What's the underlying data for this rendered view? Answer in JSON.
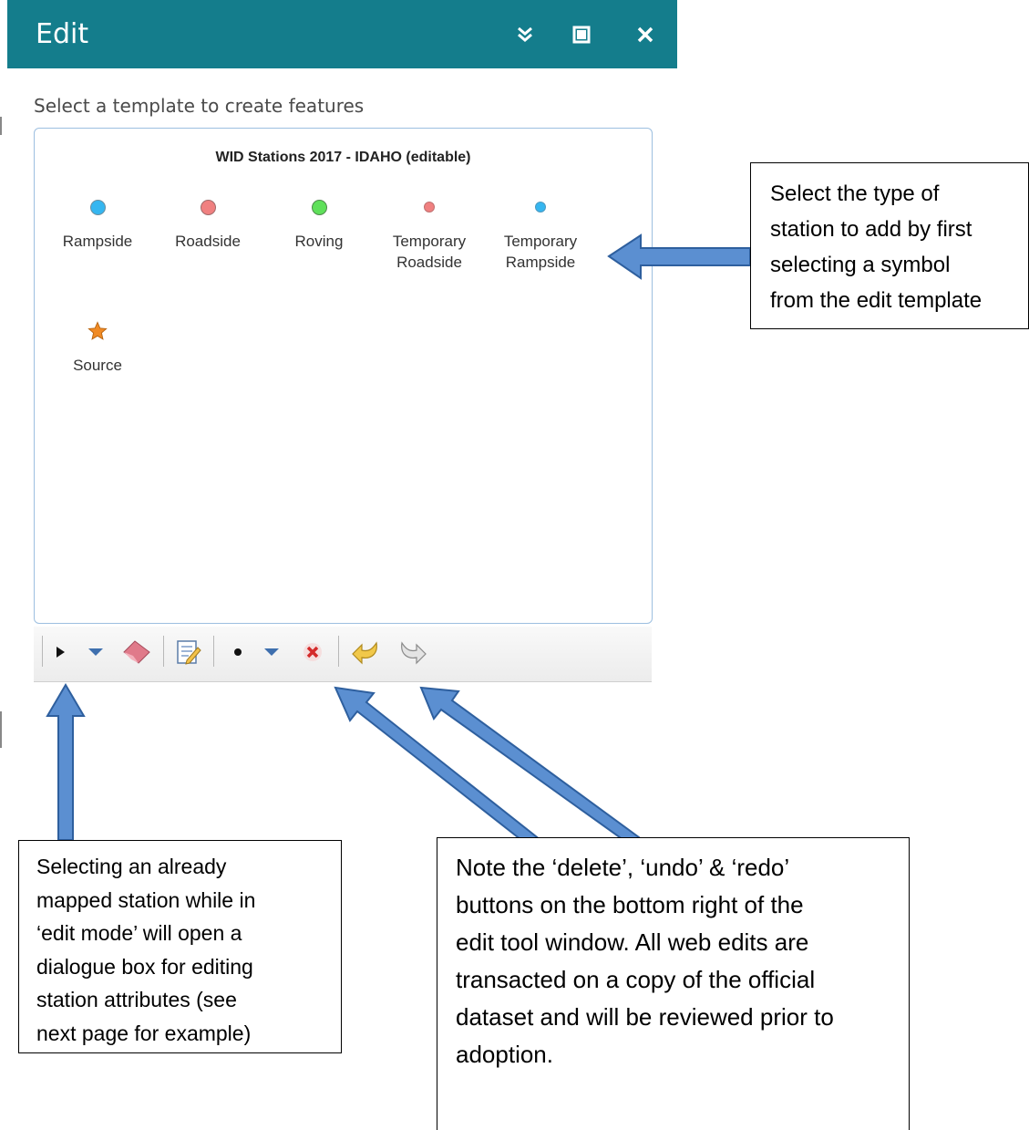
{
  "widget": {
    "title": "Edit",
    "hint": "Select a template to create features",
    "layer_title": "WID Stations 2017 - IDAHO (editable)",
    "templates": [
      {
        "label": "Rampside",
        "color": "#35b6f0",
        "symbol": "circle-large"
      },
      {
        "label": "Roadside",
        "color": "#f08080",
        "symbol": "circle-large"
      },
      {
        "label": "Roving",
        "color": "#5fe05a",
        "symbol": "circle-large"
      },
      {
        "label": "Temporary\nRoadside",
        "color": "#f08080",
        "symbol": "circle-small"
      },
      {
        "label": "Temporary\nRampside",
        "color": "#35b6f0",
        "symbol": "circle-small"
      },
      {
        "label": "Source",
        "color": "#f08a24",
        "symbol": "star"
      }
    ],
    "header_icons": [
      "collapse-chevrons-icon",
      "maximize-icon",
      "close-icon"
    ],
    "toolbar_icons": [
      "select-arrow-icon",
      "dropdown-triangle-icon",
      "eraser-icon",
      "edit-attributes-icon",
      "point-tool-icon",
      "dropdown-triangle-icon",
      "delete-icon",
      "undo-icon",
      "redo-icon"
    ]
  },
  "callouts": {
    "right": "Select the type of\nstation to add by first\nselecting a symbol\nfrom the edit template",
    "bottom_left": "Selecting an already\nmapped station while in\n‘edit mode’ will open a\ndialogue box for editing\nstation attributes (see\nnext page for example)",
    "bottom_right": "Note the ‘delete’, ‘undo’ & ‘redo’\nbuttons on the bottom right of the\nedit tool window.  All web edits are\ntransacted on a copy of the official\ndataset and will be reviewed prior to\nadoption."
  },
  "colors": {
    "header": "#147d8c",
    "arrow_fill": "#5b8fd1",
    "arrow_stroke": "#2e5f9e"
  }
}
